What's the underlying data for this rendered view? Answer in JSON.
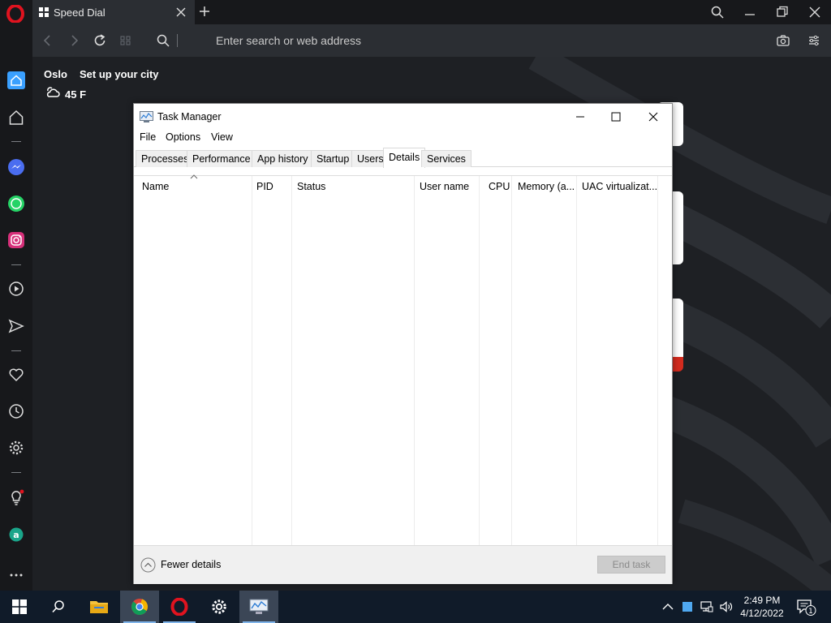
{
  "browser": {
    "tab": {
      "title": "Speed Dial"
    },
    "address": {
      "placeholder": "Enter search or web address"
    }
  },
  "weather": {
    "city": "Oslo",
    "setup": "Set up your city",
    "temperature": "45 F"
  },
  "task_manager": {
    "title": "Task Manager",
    "menu": [
      "File",
      "Options",
      "View"
    ],
    "tabs": [
      "Processes",
      "Performance",
      "App history",
      "Startup",
      "Users",
      "Details",
      "Services"
    ],
    "active_tab": "Details",
    "columns": [
      "Name",
      "PID",
      "Status",
      "User name",
      "CPU",
      "Memory (a...",
      "UAC virtualizat..."
    ],
    "rows": [],
    "footer": {
      "fewer_details": "Fewer details",
      "end_task": "End task"
    }
  },
  "taskbar": {
    "time": "2:49 PM",
    "date": "4/12/2022",
    "notification_count": "1"
  },
  "colors": {
    "opera_red": "#e0131f",
    "taskbar_bg": "#101b29",
    "accent_blue": "#3aa0ff"
  }
}
